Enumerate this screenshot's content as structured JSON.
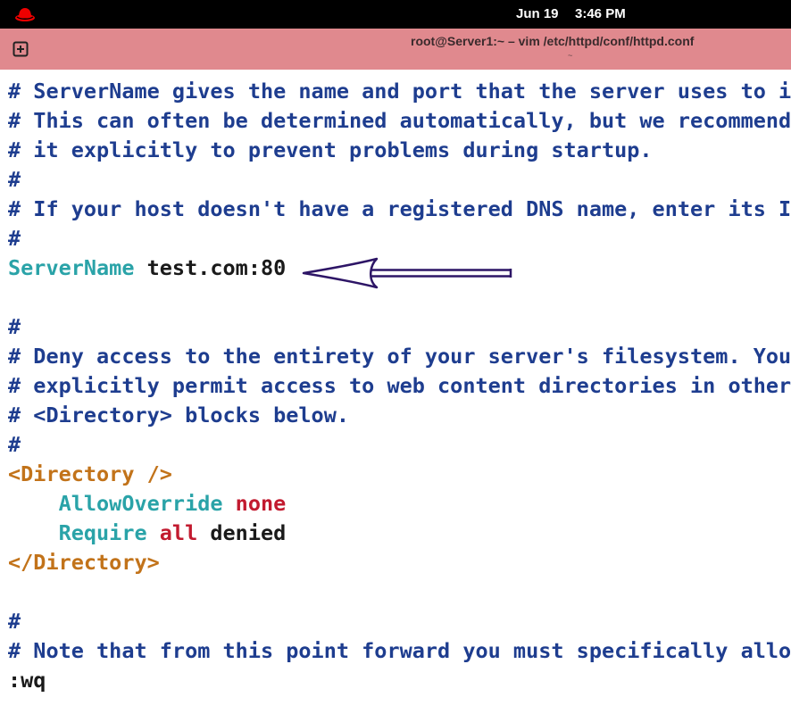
{
  "topbar": {
    "date": "Jun 19",
    "time": "3:46 PM"
  },
  "window": {
    "title": "root@Server1:~ – vim /etc/httpd/conf/httpd.conf",
    "subtitle": "~"
  },
  "lines": {
    "l1": "# ServerName gives the name and port that the server uses to id",
    "l2": "# This can often be determined automatically, but we recommend",
    "l3": "# it explicitly to prevent problems during startup.",
    "l4": "#",
    "l5": "# If your host doesn't have a registered DNS name, enter its IP",
    "l6": "#",
    "l7_directive": "ServerName",
    "l7_value": " test.com:80",
    "l8": "",
    "l9": "#",
    "l10": "# Deny access to the entirety of your server's filesystem. You",
    "l11": "# explicitly permit access to web content directories in other",
    "l12": "# <Directory> blocks below.",
    "l13": "#",
    "l14": "<Directory />",
    "l15_indent": "    ",
    "l15_directive": "AllowOverride",
    "l15_value": " none",
    "l16_indent": "    ",
    "l16_directive": "Require",
    "l16_value1": " all",
    "l16_value2": " denied",
    "l17": "</Directory>",
    "l18": "",
    "l19": "#",
    "l20": "# Note that from this point forward you must specifically allow"
  },
  "cmdline": ":wq",
  "colors": {
    "topbar": "#000000",
    "titlebar": "#e0898e",
    "comment": "#1e3d8f",
    "keyword": "#2aa3a8",
    "tag": "#c2731a",
    "value": "#c21a2f",
    "arrow": "#2d1566"
  },
  "icons": {
    "logo": "redhat-logo",
    "new_tab": "new-tab-icon",
    "annotation": "arrow-left"
  }
}
